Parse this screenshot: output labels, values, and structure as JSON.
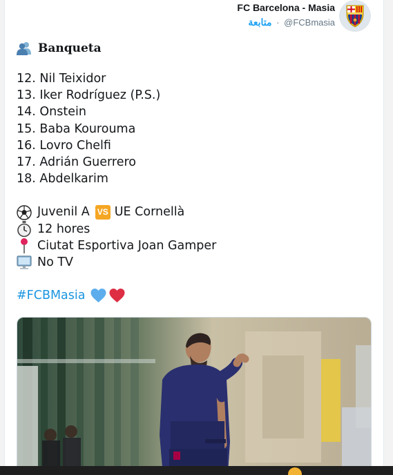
{
  "tweet": {
    "display_name": "FC Barcelona - Masia",
    "handle": "@FCBmasia",
    "follow_label": "متابعة",
    "separator": "·",
    "heading": "Banqueta",
    "bench": [
      "12. Nil Teixidor",
      "13. Iker Rodríguez (P.S.)",
      "14. Onstein",
      "15. Baba Kourouma",
      "16. Lovro Chelfi",
      "17. Adrián Guerrero",
      "18. Abdelkarim"
    ],
    "match": {
      "home": "Juvenil A",
      "vs_badge": "VS",
      "away": "UE Cornellà",
      "time": "12 hores",
      "venue": "Ciutat Esportiva Joan Gamper",
      "tv": "No TV"
    },
    "hashtag": "#FCBMasia"
  },
  "icons": {
    "heading": "busts-in-silhouette-icon",
    "match": "soccer-ball-icon",
    "time": "stopwatch-icon",
    "venue": "round-pushpin-icon",
    "tv": "desktop-computer-icon",
    "hearts": [
      "blue-heart-icon",
      "red-heart-icon"
    ]
  },
  "colors": {
    "link": "#1b95e0",
    "follow": "#1da1f2",
    "text": "#14171a",
    "muted": "#657786",
    "vs_badge": "#f5a623"
  }
}
